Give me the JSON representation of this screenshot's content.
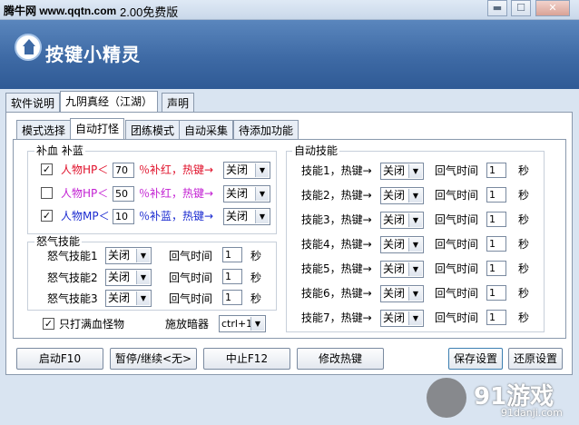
{
  "watermark": "腾牛网 www.qqtn.com",
  "window_title": "2.00免费版",
  "brand": "按键小精灵",
  "main_tabs": [
    "软件说明",
    "九阴真经（江湖）",
    "声明"
  ],
  "sub_tabs": [
    "模式选择",
    "自动打怪",
    "团练模式",
    "自动采集",
    "待添加功能"
  ],
  "supply": {
    "title": "补血 补蓝",
    "rows": [
      {
        "checked": "✓",
        "label": "人物HP＜",
        "value": "70",
        "suffix": "％补红，热键→",
        "hotkey": "关闭",
        "color": "#e0102a"
      },
      {
        "checked": "",
        "label": "人物HP＜",
        "value": "50",
        "suffix": "％补红，热键→",
        "hotkey": "关闭",
        "color": "#c21fd2"
      },
      {
        "checked": "✓",
        "label": "人物MP＜",
        "value": "10",
        "suffix": "％补蓝，热键→",
        "hotkey": "关闭",
        "color": "#1a2ad0"
      }
    ]
  },
  "rage": {
    "title": "怒气技能",
    "rows": [
      {
        "label": "怒气技能1",
        "hotkey": "关闭",
        "cd_label": "回气时间",
        "cd": "1",
        "unit": "秒"
      },
      {
        "label": "怒气技能2",
        "hotkey": "关闭",
        "cd_label": "回气时间",
        "cd": "1",
        "unit": "秒"
      },
      {
        "label": "怒气技能3",
        "hotkey": "关闭",
        "cd_label": "回气时间",
        "cd": "1",
        "unit": "秒"
      }
    ]
  },
  "only_full_hp": {
    "checked": "✓",
    "label": "只打满血怪物"
  },
  "hidden_weapon": {
    "label": "施放暗器",
    "value": "ctrl+1"
  },
  "auto_skills": {
    "title": "自动技能",
    "rows": [
      {
        "label": "技能1，热键→",
        "hotkey": "关闭",
        "cd_label": "回气时间",
        "cd": "1",
        "unit": "秒"
      },
      {
        "label": "技能2，热键→",
        "hotkey": "关闭",
        "cd_label": "回气时间",
        "cd": "1",
        "unit": "秒"
      },
      {
        "label": "技能3，热键→",
        "hotkey": "关闭",
        "cd_label": "回气时间",
        "cd": "1",
        "unit": "秒"
      },
      {
        "label": "技能4，热键→",
        "hotkey": "关闭",
        "cd_label": "回气时间",
        "cd": "1",
        "unit": "秒"
      },
      {
        "label": "技能5，热键→",
        "hotkey": "关闭",
        "cd_label": "回气时间",
        "cd": "1",
        "unit": "秒"
      },
      {
        "label": "技能6，热键→",
        "hotkey": "关闭",
        "cd_label": "回气时间",
        "cd": "1",
        "unit": "秒"
      },
      {
        "label": "技能7，热键→",
        "hotkey": "关闭",
        "cd_label": "回气时间",
        "cd": "1",
        "unit": "秒"
      }
    ]
  },
  "buttons": {
    "start": "启动F10",
    "pause": "暂停/继续<无>",
    "stop": "中止F12",
    "edit_hotkey": "修改热键",
    "save": "保存设置",
    "restore": "还原设置"
  },
  "site_logo": {
    "name": "91游戏",
    "url": "91danji.com"
  }
}
